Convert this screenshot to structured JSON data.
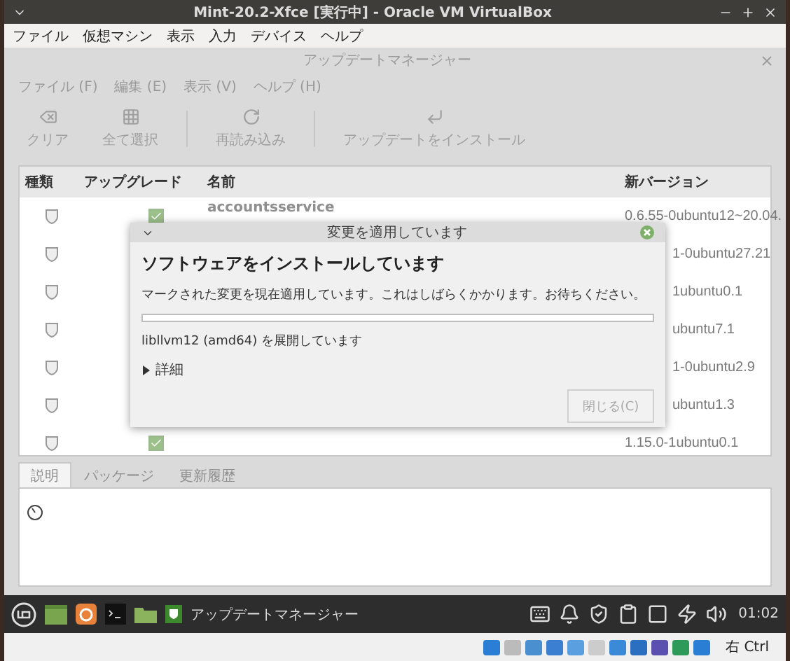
{
  "host_window": {
    "title": "Mint-20.2-Xfce [実行中] - Oracle VM VirtualBox",
    "menu": [
      "ファイル",
      "仮想マシン",
      "表示",
      "入力",
      "デバイス",
      "ヘルプ"
    ]
  },
  "app_window": {
    "title": "アップデートマネージャー",
    "menu": [
      "ファイル (F)",
      "編集 (E)",
      "表示 (V)",
      "ヘルプ (H)"
    ],
    "toolbar": [
      {
        "label": "クリア",
        "kind": "clear"
      },
      {
        "label": "全て選択",
        "kind": "select"
      },
      {
        "label": "再読み込み",
        "kind": "reload"
      },
      {
        "label": "アップデートをインストール",
        "kind": "install"
      }
    ]
  },
  "table": {
    "columns": [
      "種類",
      "アップグレード",
      "名前",
      "新バージョン"
    ],
    "rows": [
      {
        "name": "accountsservice",
        "checked": true,
        "version": "0.6.55-0ubuntu12~20.04."
      },
      {
        "kind": "covered",
        "version": "1-0ubuntu27.21"
      },
      {
        "kind": "covered",
        "version": "1ubuntu0.1"
      },
      {
        "kind": "covered",
        "version": "ubuntu7.1"
      },
      {
        "kind": "covered",
        "version": "1-0ubuntu2.9"
      },
      {
        "kind": "covered",
        "version": "ubuntu1.3"
      },
      {
        "checked": true,
        "version": "1.15.0-1ubuntu0.1"
      }
    ]
  },
  "dialog": {
    "title": "変更を適用しています",
    "heading": "ソフトウェアをインストールしています",
    "message": "マークされた変更を現在適用しています。これはしばらくかかります。お待ちください。",
    "progress": {
      "level": 0
    },
    "status": "libllvm12 (amd64) を展開しています",
    "details": {
      "label": "詳細",
      "expanded": false
    },
    "close_button": {
      "label": "閉じる(C)",
      "disabled": true
    }
  },
  "bottom_tabs": [
    {
      "label": "説明",
      "selected": true
    },
    {
      "label": "パッケージ",
      "selected": false
    },
    {
      "label": "更新履歴",
      "selected": false
    }
  ],
  "taskbar": {
    "window_label": "アップデートマネージャー",
    "clock": "01:02"
  },
  "status_bar": {
    "host_key": "右 Ctrl"
  }
}
